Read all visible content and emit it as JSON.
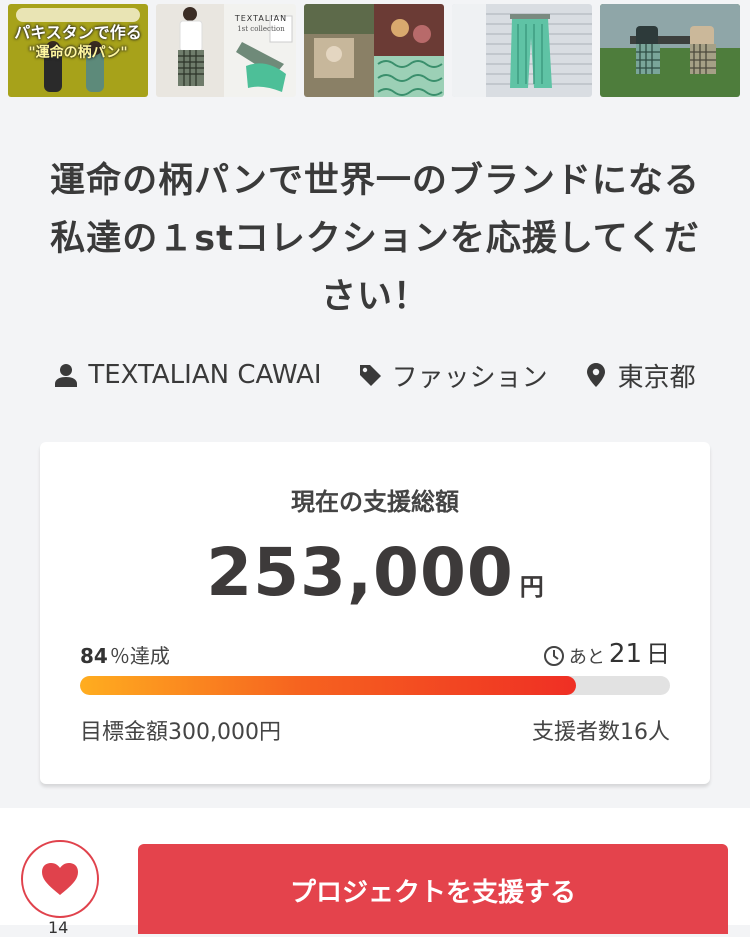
{
  "gallery": {
    "thumb1": {
      "line1": "パキスタンで作る",
      "line2": "\"運命の柄パン\""
    },
    "thumb2": {
      "brand": "TEXTALIAN",
      "sub": "1st collection"
    }
  },
  "project": {
    "title": "運命の柄パンで世界一のブランドになる私達の１stコレクションを応援してください！",
    "owner": "TEXTALIAN CAWAI",
    "category": "ファッション",
    "location": "東京都"
  },
  "funding": {
    "label": "現在の支援総額",
    "amount": "253,000",
    "currency": "円",
    "percent": "84",
    "percent_label": "％達成",
    "progress": 0.84,
    "days_prefix": "あと",
    "days": "21",
    "days_unit": "日",
    "goal": "目標金額300,000円",
    "backers": "支援者数16人"
  },
  "actions": {
    "support_label": "プロジェクトを支援する",
    "favorite_count": "14"
  },
  "colors": {
    "accent": "#e4434c",
    "progress_start": "#ffad1f",
    "progress_end": "#ef2f24"
  }
}
